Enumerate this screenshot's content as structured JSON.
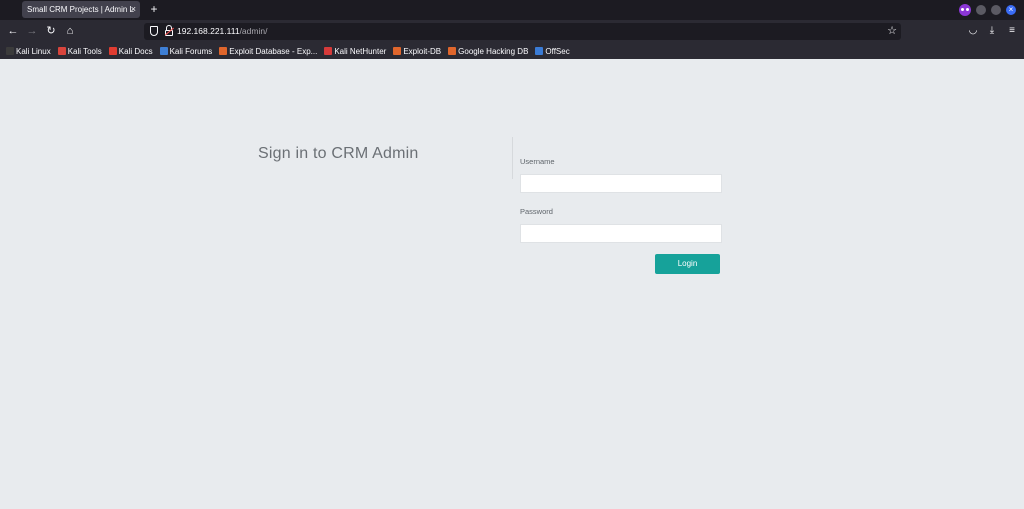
{
  "browser": {
    "tab_title": "Small CRM Projects | Admin L",
    "tab_close": "×",
    "new_tab": "+",
    "url_host": "192.168.221.111",
    "url_path": "/admin/",
    "nav": {
      "back": "←",
      "forward": "→",
      "reload": "↻",
      "home": "⌂"
    },
    "icons": {
      "star": "☆",
      "pocket": "◡",
      "download": "⤓",
      "menu": "≡",
      "window_close": "×"
    }
  },
  "bookmarks": [
    {
      "label": "Kali Linux",
      "color": "#3b3b3b"
    },
    {
      "label": "Kali Tools",
      "color": "#d8443c"
    },
    {
      "label": "Kali Docs",
      "color": "#e03c31"
    },
    {
      "label": "Kali Forums",
      "color": "#3e7fd6"
    },
    {
      "label": "Exploit Database - Exp...",
      "color": "#e0662c"
    },
    {
      "label": "Kali NetHunter",
      "color": "#d63a3a"
    },
    {
      "label": "Exploit-DB",
      "color": "#e0662c"
    },
    {
      "label": "Google Hacking DB",
      "color": "#e0662c"
    },
    {
      "label": "OffSec",
      "color": "#3a7bd5"
    }
  ],
  "login": {
    "title": "Sign in to CRM Admin",
    "username_label": "Username",
    "username_value": "",
    "password_label": "Password",
    "password_value": "",
    "login_button": "Login"
  },
  "colors": {
    "page_bg": "#e8ebee",
    "accent": "#16a29a"
  }
}
